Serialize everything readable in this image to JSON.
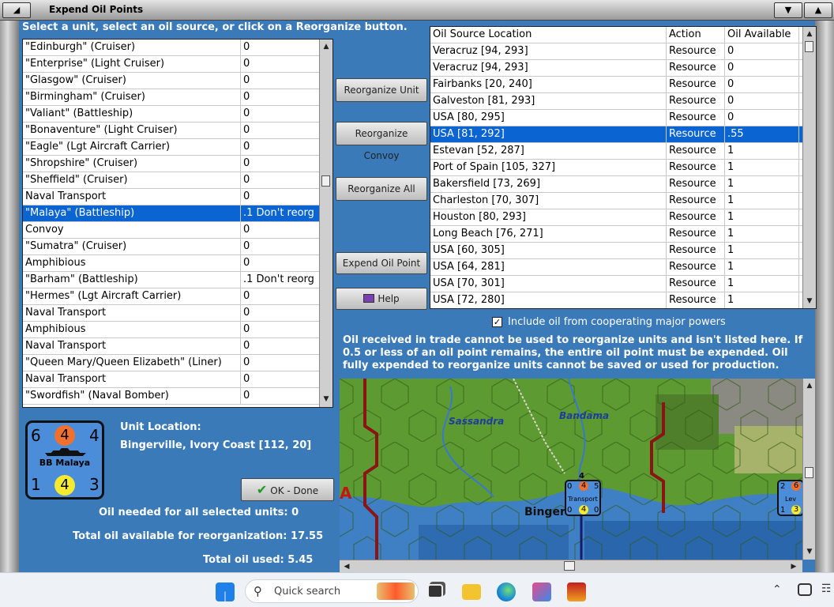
{
  "window": {
    "title": "Expend Oil Points"
  },
  "instructions": "Select a unit, select an oil source, or click on a Reorganize button.",
  "units": [
    {
      "name": "\"Edinburgh\" (Cruiser)",
      "oil": "0"
    },
    {
      "name": "\"Enterprise\" (Light Cruiser)",
      "oil": "0"
    },
    {
      "name": "\"Glasgow\" (Cruiser)",
      "oil": "0"
    },
    {
      "name": "\"Birmingham\" (Cruiser)",
      "oil": "0"
    },
    {
      "name": "\"Valiant\" (Battleship)",
      "oil": "0"
    },
    {
      "name": "\"Bonaventure\" (Light Cruiser)",
      "oil": "0"
    },
    {
      "name": "\"Eagle\" (Lgt Aircraft Carrier)",
      "oil": "0"
    },
    {
      "name": "\"Shropshire\" (Cruiser)",
      "oil": "0"
    },
    {
      "name": "\"Sheffield\" (Cruiser)",
      "oil": "0"
    },
    {
      "name": "Naval Transport",
      "oil": "0"
    },
    {
      "name": "\"Malaya\" (Battleship)",
      "oil": ".1 Don't reorg",
      "selected": true
    },
    {
      "name": "Convoy",
      "oil": "0"
    },
    {
      "name": "\"Sumatra\" (Cruiser)",
      "oil": "0"
    },
    {
      "name": "Amphibious",
      "oil": "0"
    },
    {
      "name": "\"Barham\" (Battleship)",
      "oil": ".1 Don't reorg"
    },
    {
      "name": "\"Hermes\" (Lgt Aircraft Carrier)",
      "oil": "0"
    },
    {
      "name": "Naval Transport",
      "oil": "0"
    },
    {
      "name": "Amphibious",
      "oil": "0"
    },
    {
      "name": "Naval Transport",
      "oil": "0"
    },
    {
      "name": "\"Queen Mary/Queen Elizabeth\" (Liner)",
      "oil": "0"
    },
    {
      "name": "Naval Transport",
      "oil": "0"
    },
    {
      "name": "\"Swordfish\" (Naval Bomber)",
      "oil": "0"
    }
  ],
  "buttons": {
    "reorganize_unit": "Reorganize Unit",
    "reorganize_convoy": "Reorganize Convoy",
    "reorganize_all": "Reorganize All",
    "expend_oil_point": "Expend Oil Point",
    "help": "Help",
    "ok_done": "OK - Done"
  },
  "oil_sources": {
    "columns": [
      "Oil Source Location",
      "Action",
      "Oil Available"
    ],
    "rows": [
      {
        "location": "Veracruz [94, 293]",
        "action": "Resource",
        "available": "0"
      },
      {
        "location": "Veracruz [94, 293]",
        "action": "Resource",
        "available": "0"
      },
      {
        "location": "Fairbanks [20, 240]",
        "action": "Resource",
        "available": "0"
      },
      {
        "location": "Galveston [81, 293]",
        "action": "Resource",
        "available": "0"
      },
      {
        "location": "USA [80, 295]",
        "action": "Resource",
        "available": "0"
      },
      {
        "location": "USA [81, 292]",
        "action": "Resource",
        "available": ".55",
        "selected": true
      },
      {
        "location": "Estevan [52, 287]",
        "action": "Resource",
        "available": "1"
      },
      {
        "location": "Port of Spain [105, 327]",
        "action": "Resource",
        "available": "1"
      },
      {
        "location": "Bakersfield [73, 269]",
        "action": "Resource",
        "available": "1"
      },
      {
        "location": "Charleston [70, 307]",
        "action": "Resource",
        "available": "1"
      },
      {
        "location": "Houston [80, 293]",
        "action": "Resource",
        "available": "1"
      },
      {
        "location": "Long Beach [76, 271]",
        "action": "Resource",
        "available": "1"
      },
      {
        "location": "USA [60, 305]",
        "action": "Resource",
        "available": "1"
      },
      {
        "location": "USA [64, 281]",
        "action": "Resource",
        "available": "1"
      },
      {
        "location": "USA [70, 301]",
        "action": "Resource",
        "available": "1"
      },
      {
        "location": "USA [72, 280]",
        "action": "Resource",
        "available": "1"
      }
    ]
  },
  "cooperating": {
    "label": "Include oil from cooperating major powers",
    "checked": true
  },
  "note": {
    "line1": "Oil received in trade cannot be used to reorganize units and isn't listed here.  If",
    "line2": "0.5 or less of an oil point remains, the entire oil point must be expended.   Oil",
    "line3": "fully expended to reorganize units cannot be saved or used for production."
  },
  "unit_info": {
    "location_label": "Unit Location:",
    "location_value": "Bingerville, Ivory Coast [112, 20]"
  },
  "counter": {
    "top_left": "6",
    "top_center": "4",
    "top_right": "4",
    "label": "BB Malaya",
    "bottom_left": "1",
    "bottom_center": "4",
    "bottom_right": "3",
    "colors": {
      "bg": "#4b8dd8",
      "orange": "#f07030",
      "yellow": "#f5ea30"
    }
  },
  "totals": {
    "needed_label": "Oil needed for all selected units:",
    "needed_value": "0",
    "available_label": "Total oil available for reorganization:",
    "available_value": "17.55",
    "used_label": "Total oil used:",
    "used_value": "5.45"
  },
  "map": {
    "labels": {
      "river1": "Sassandra",
      "river2": "Bandama",
      "city": "Binger",
      "edge": "A"
    },
    "stack1": {
      "tl": "0",
      "tc": "4",
      "tr": "5",
      "label": "Transport",
      "bl": "0",
      "bc": "4",
      "br": "0",
      "top": "4"
    },
    "stack2": {
      "tl": "2",
      "tc": "6",
      "label": "Lev",
      "bl": "1",
      "bc": "3"
    }
  },
  "taskbar": {
    "search_placeholder": "Quick search"
  }
}
